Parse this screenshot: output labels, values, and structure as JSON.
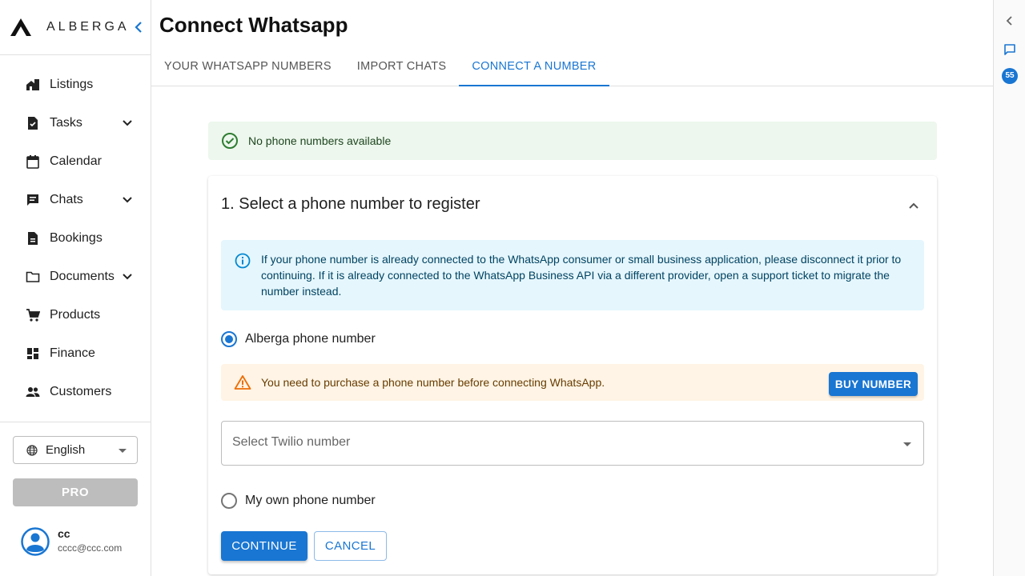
{
  "brand": {
    "name": "ALBERGA"
  },
  "sidebar": {
    "items": [
      {
        "label": "Listings",
        "icon": "home-work-icon",
        "expandable": false
      },
      {
        "label": "Tasks",
        "icon": "task-icon",
        "expandable": true
      },
      {
        "label": "Calendar",
        "icon": "calendar-icon",
        "expandable": false
      },
      {
        "label": "Chats",
        "icon": "chat-icon",
        "expandable": true
      },
      {
        "label": "Bookings",
        "icon": "document-icon",
        "expandable": false
      },
      {
        "label": "Documents",
        "icon": "folder-icon",
        "expandable": true
      },
      {
        "label": "Products",
        "icon": "cart-icon",
        "expandable": false
      },
      {
        "label": "Finance",
        "icon": "dashboard-icon",
        "expandable": false
      },
      {
        "label": "Customers",
        "icon": "people-icon",
        "expandable": false
      }
    ],
    "language": "English",
    "pro_label": "PRO",
    "user": {
      "name": "cc",
      "email": "cccc@ccc.com"
    }
  },
  "main": {
    "title": "Connect Whatsapp",
    "tabs": [
      {
        "label": "YOUR WHATSAPP NUMBERS",
        "active": false
      },
      {
        "label": "IMPORT CHATS",
        "active": false
      },
      {
        "label": "CONNECT A NUMBER",
        "active": true
      }
    ],
    "success_alert": "No phone numbers available",
    "step": {
      "title": "1. Select a phone number to register",
      "info_text": "If your phone number is already connected to the WhatsApp consumer or small business application, please disconnect it prior to continuing. If it is already connected to the WhatsApp Business API via a different provider, open a support ticket to migrate the number instead.",
      "option_alberga": "Alberga phone number",
      "warning_text": "You need to purchase a phone number before connecting WhatsApp.",
      "buy_label": "BUY NUMBER",
      "select_placeholder": "Select Twilio number",
      "option_own": "My own phone number",
      "continue_label": "CONTINUE",
      "cancel_label": "CANCEL"
    }
  },
  "rail": {
    "badge_count": "55"
  },
  "colors": {
    "accent": "#1976d2",
    "success_bg": "#edf7ed",
    "info_bg": "#e5f6fd",
    "warning_bg": "#fff4e5"
  }
}
